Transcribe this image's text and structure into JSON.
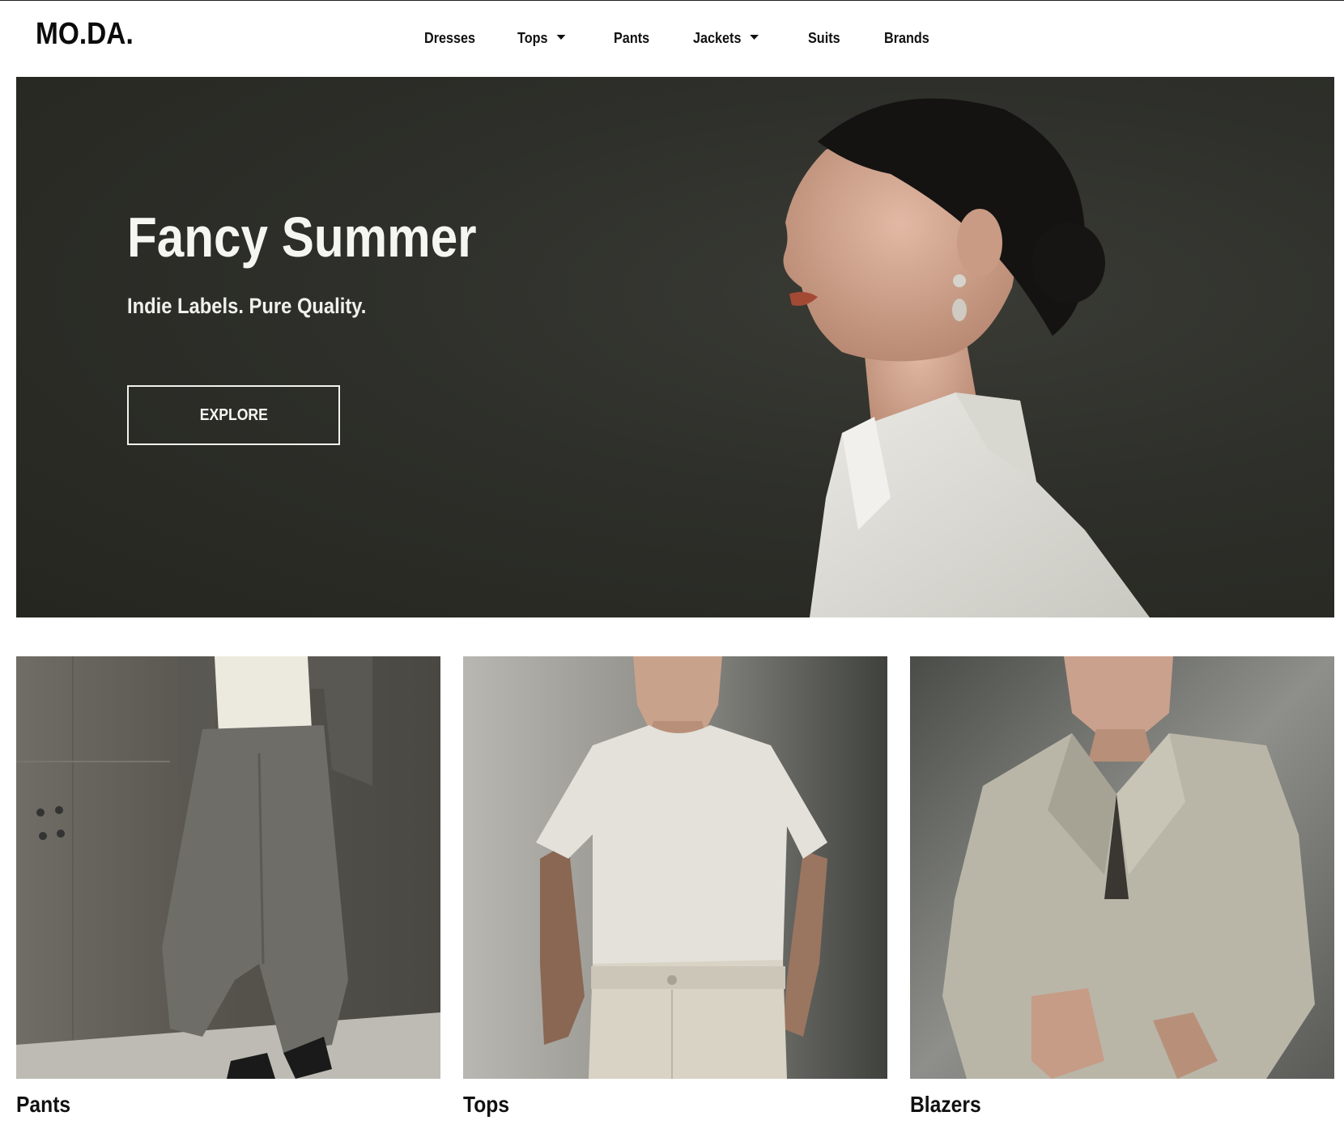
{
  "header": {
    "logo": "MO.DA.",
    "nav": [
      {
        "label": "Dresses",
        "has_dropdown": false
      },
      {
        "label": "Tops",
        "has_dropdown": true
      },
      {
        "label": "Pants",
        "has_dropdown": false
      },
      {
        "label": "Jackets",
        "has_dropdown": true
      },
      {
        "label": "Suits",
        "has_dropdown": false
      },
      {
        "label": "Brands",
        "has_dropdown": false
      }
    ]
  },
  "hero": {
    "title": "Fancy Summer",
    "subtitle": "Indie Labels. Pure Quality.",
    "cta_label": "EXPLORE",
    "image": "woman-profile-white-collar-photo"
  },
  "categories": [
    {
      "label": "Pants",
      "image": "grey-wide-pants-photo"
    },
    {
      "label": "Tops",
      "image": "cream-tshirt-photo"
    },
    {
      "label": "Blazers",
      "image": "beige-blazer-photo"
    }
  ],
  "colors": {
    "hero_bg": "#2e2f2a",
    "text_dark": "#111111",
    "text_light": "#f5f5f2"
  }
}
